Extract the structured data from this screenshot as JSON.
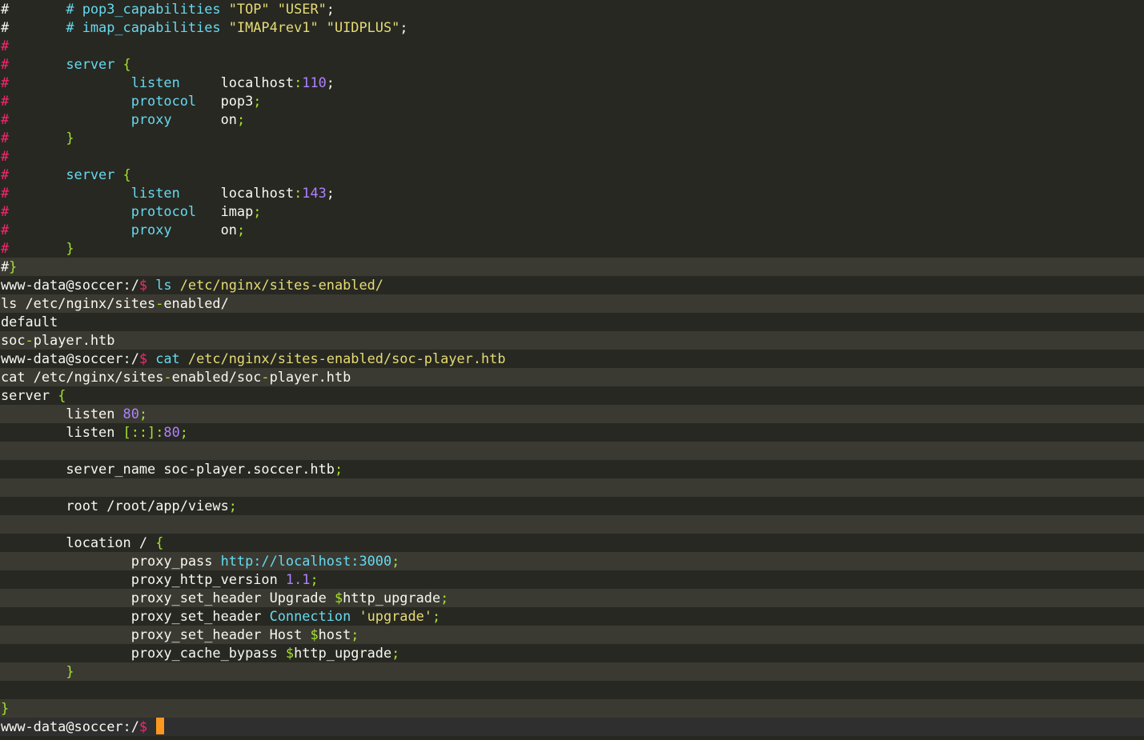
{
  "colors": {
    "background": "#272822",
    "foreground": "#f8f8f2",
    "comment_hash": "#f92672",
    "keyword_blue": "#66d9ef",
    "string_yellow": "#e6db74",
    "number_purple": "#ae81ff",
    "brace_green": "#a6e22e",
    "prompt_dollar": "#f92672",
    "cursor": "#fd971f"
  },
  "terminal": {
    "lines": [
      {
        "tokens": [
          {
            "t": "#",
            "c": "#f8f8f2"
          },
          {
            "t": "       ",
            "c": "#f8f8f2"
          },
          {
            "t": "# pop3_capabilities",
            "c": "#66d9ef"
          },
          {
            "t": " ",
            "c": "#f8f8f2"
          },
          {
            "t": "\"TOP\" \"USER\"",
            "c": "#e6db74"
          },
          {
            "t": ";",
            "c": "#f8f8f2"
          }
        ]
      },
      {
        "tokens": [
          {
            "t": "#",
            "c": "#f8f8f2"
          },
          {
            "t": "       ",
            "c": "#f8f8f2"
          },
          {
            "t": "# imap_capabilities",
            "c": "#66d9ef"
          },
          {
            "t": " ",
            "c": "#f8f8f2"
          },
          {
            "t": "\"IMAP4rev1\" \"UIDPLUS\"",
            "c": "#e6db74"
          },
          {
            "t": ";",
            "c": "#f8f8f2"
          }
        ]
      },
      {
        "tokens": [
          {
            "t": "#",
            "c": "#f92672"
          }
        ]
      },
      {
        "tokens": [
          {
            "t": "#",
            "c": "#f92672"
          },
          {
            "t": "       ",
            "c": "#f8f8f2"
          },
          {
            "t": "server",
            "c": "#66d9ef"
          },
          {
            "t": " ",
            "c": "#f8f8f2"
          },
          {
            "t": "{",
            "c": "#a6e22e"
          }
        ]
      },
      {
        "tokens": [
          {
            "t": "#",
            "c": "#f92672"
          },
          {
            "t": "               ",
            "c": "#f8f8f2"
          },
          {
            "t": "listen",
            "c": "#66d9ef"
          },
          {
            "t": "     localhost",
            "c": "#f8f8f2"
          },
          {
            "t": ":",
            "c": "#a6e22e"
          },
          {
            "t": "110",
            "c": "#ae81ff"
          },
          {
            "t": ";",
            "c": "#f8f8f2"
          }
        ]
      },
      {
        "tokens": [
          {
            "t": "#",
            "c": "#f92672"
          },
          {
            "t": "               ",
            "c": "#f8f8f2"
          },
          {
            "t": "protocol",
            "c": "#66d9ef"
          },
          {
            "t": "   pop3",
            "c": "#f8f8f2"
          },
          {
            "t": ";",
            "c": "#a6e22e"
          }
        ]
      },
      {
        "tokens": [
          {
            "t": "#",
            "c": "#f92672"
          },
          {
            "t": "               ",
            "c": "#f8f8f2"
          },
          {
            "t": "proxy",
            "c": "#66d9ef"
          },
          {
            "t": "      on",
            "c": "#f8f8f2"
          },
          {
            "t": ";",
            "c": "#a6e22e"
          }
        ]
      },
      {
        "tokens": [
          {
            "t": "#",
            "c": "#f92672"
          },
          {
            "t": "       ",
            "c": "#f8f8f2"
          },
          {
            "t": "}",
            "c": "#a6e22e"
          }
        ]
      },
      {
        "tokens": [
          {
            "t": "#",
            "c": "#f92672"
          }
        ]
      },
      {
        "tokens": [
          {
            "t": "#",
            "c": "#f92672"
          },
          {
            "t": "       ",
            "c": "#f8f8f2"
          },
          {
            "t": "server",
            "c": "#66d9ef"
          },
          {
            "t": " ",
            "c": "#f8f8f2"
          },
          {
            "t": "{",
            "c": "#a6e22e"
          }
        ]
      },
      {
        "tokens": [
          {
            "t": "#",
            "c": "#f92672"
          },
          {
            "t": "               ",
            "c": "#f8f8f2"
          },
          {
            "t": "listen",
            "c": "#66d9ef"
          },
          {
            "t": "     localhost",
            "c": "#f8f8f2"
          },
          {
            "t": ":",
            "c": "#a6e22e"
          },
          {
            "t": "143",
            "c": "#ae81ff"
          },
          {
            "t": ";",
            "c": "#f8f8f2"
          }
        ]
      },
      {
        "tokens": [
          {
            "t": "#",
            "c": "#f92672"
          },
          {
            "t": "               ",
            "c": "#f8f8f2"
          },
          {
            "t": "protocol",
            "c": "#66d9ef"
          },
          {
            "t": "   imap",
            "c": "#f8f8f2"
          },
          {
            "t": ";",
            "c": "#a6e22e"
          }
        ]
      },
      {
        "tokens": [
          {
            "t": "#",
            "c": "#f92672"
          },
          {
            "t": "               ",
            "c": "#f8f8f2"
          },
          {
            "t": "proxy",
            "c": "#66d9ef"
          },
          {
            "t": "      on",
            "c": "#f8f8f2"
          },
          {
            "t": ";",
            "c": "#a6e22e"
          }
        ]
      },
      {
        "tokens": [
          {
            "t": "#",
            "c": "#f92672"
          },
          {
            "t": "       ",
            "c": "#f8f8f2"
          },
          {
            "t": "}",
            "c": "#a6e22e"
          }
        ]
      },
      {
        "tokens": [
          {
            "t": "#",
            "c": "#f8f8f2"
          },
          {
            "t": "}",
            "c": "#a6e22e"
          }
        ]
      },
      {
        "tokens": [
          {
            "t": "www-data@soccer:/",
            "c": "#f8f8f2"
          },
          {
            "t": "$",
            "c": "#f92672"
          },
          {
            "t": " ls ",
            "c": "#66d9ef"
          },
          {
            "t": "/etc/nginx/sites-enabled/",
            "c": "#e6db74"
          }
        ]
      },
      {
        "tokens": [
          {
            "t": "ls /etc/nginx/sites",
            "c": "#f8f8f2"
          },
          {
            "t": "-",
            "c": "#a6e22e"
          },
          {
            "t": "enabled/",
            "c": "#f8f8f2"
          }
        ]
      },
      {
        "tokens": [
          {
            "t": "default",
            "c": "#f8f8f2"
          }
        ]
      },
      {
        "tokens": [
          {
            "t": "soc",
            "c": "#f8f8f2"
          },
          {
            "t": "-",
            "c": "#a6e22e"
          },
          {
            "t": "player.htb",
            "c": "#f8f8f2"
          }
        ]
      },
      {
        "tokens": [
          {
            "t": "www-data@soccer:/",
            "c": "#f8f8f2"
          },
          {
            "t": "$",
            "c": "#f92672"
          },
          {
            "t": " cat ",
            "c": "#66d9ef"
          },
          {
            "t": "/etc/nginx/sites-enabled/soc-player.htb",
            "c": "#e6db74"
          }
        ]
      },
      {
        "tokens": [
          {
            "t": "cat /etc/nginx/sites",
            "c": "#f8f8f2"
          },
          {
            "t": "-",
            "c": "#a6e22e"
          },
          {
            "t": "enabled/soc",
            "c": "#f8f8f2"
          },
          {
            "t": "-",
            "c": "#a6e22e"
          },
          {
            "t": "player.htb",
            "c": "#f8f8f2"
          }
        ]
      },
      {
        "tokens": [
          {
            "t": "server ",
            "c": "#f8f8f2"
          },
          {
            "t": "{",
            "c": "#a6e22e"
          }
        ]
      },
      {
        "tokens": [
          {
            "t": "        listen ",
            "c": "#f8f8f2"
          },
          {
            "t": "80",
            "c": "#ae81ff"
          },
          {
            "t": ";",
            "c": "#a6e22e"
          }
        ]
      },
      {
        "tokens": [
          {
            "t": "        listen ",
            "c": "#f8f8f2"
          },
          {
            "t": "[::]:",
            "c": "#a6e22e"
          },
          {
            "t": "80",
            "c": "#ae81ff"
          },
          {
            "t": ";",
            "c": "#a6e22e"
          }
        ]
      },
      {
        "tokens": [
          {
            "t": "",
            "c": "#f8f8f2"
          }
        ]
      },
      {
        "tokens": [
          {
            "t": "        server_name soc-player.soccer.htb",
            "c": "#f8f8f2"
          },
          {
            "t": ";",
            "c": "#a6e22e"
          }
        ]
      },
      {
        "tokens": [
          {
            "t": "",
            "c": "#f8f8f2"
          }
        ]
      },
      {
        "tokens": [
          {
            "t": "        root /root/app/views",
            "c": "#f8f8f2"
          },
          {
            "t": ";",
            "c": "#a6e22e"
          }
        ]
      },
      {
        "tokens": [
          {
            "t": "",
            "c": "#f8f8f2"
          }
        ]
      },
      {
        "tokens": [
          {
            "t": "        location / ",
            "c": "#f8f8f2"
          },
          {
            "t": "{",
            "c": "#a6e22e"
          }
        ]
      },
      {
        "tokens": [
          {
            "t": "                proxy_pass ",
            "c": "#f8f8f2"
          },
          {
            "t": "http://localhost:3000",
            "c": "#66d9ef"
          },
          {
            "t": ";",
            "c": "#a6e22e"
          }
        ]
      },
      {
        "tokens": [
          {
            "t": "                proxy_http_version ",
            "c": "#f8f8f2"
          },
          {
            "t": "1.1",
            "c": "#ae81ff"
          },
          {
            "t": ";",
            "c": "#a6e22e"
          }
        ]
      },
      {
        "tokens": [
          {
            "t": "                proxy_set_header Upgrade ",
            "c": "#f8f8f2"
          },
          {
            "t": "$",
            "c": "#a6e22e"
          },
          {
            "t": "http_upgrade",
            "c": "#f8f8f2"
          },
          {
            "t": ";",
            "c": "#a6e22e"
          }
        ]
      },
      {
        "tokens": [
          {
            "t": "                proxy_set_header ",
            "c": "#f8f8f2"
          },
          {
            "t": "Connection",
            "c": "#66d9ef"
          },
          {
            "t": " ",
            "c": "#f8f8f2"
          },
          {
            "t": "'upgrade'",
            "c": "#e6db74"
          },
          {
            "t": ";",
            "c": "#a6e22e"
          }
        ]
      },
      {
        "tokens": [
          {
            "t": "                proxy_set_header Host ",
            "c": "#f8f8f2"
          },
          {
            "t": "$",
            "c": "#a6e22e"
          },
          {
            "t": "host",
            "c": "#f8f8f2"
          },
          {
            "t": ";",
            "c": "#a6e22e"
          }
        ]
      },
      {
        "tokens": [
          {
            "t": "                proxy_cache_bypass ",
            "c": "#f8f8f2"
          },
          {
            "t": "$",
            "c": "#a6e22e"
          },
          {
            "t": "http_upgrade",
            "c": "#f8f8f2"
          },
          {
            "t": ";",
            "c": "#a6e22e"
          }
        ]
      },
      {
        "tokens": [
          {
            "t": "        ",
            "c": "#f8f8f2"
          },
          {
            "t": "}",
            "c": "#a6e22e"
          }
        ]
      },
      {
        "tokens": [
          {
            "t": "",
            "c": "#f8f8f2"
          }
        ]
      },
      {
        "tokens": [
          {
            "t": "}",
            "c": "#a6e22e"
          }
        ]
      },
      {
        "tokens": [
          {
            "t": "www-data@soccer:/",
            "c": "#f8f8f2"
          },
          {
            "t": "$",
            "c": "#f92672"
          },
          {
            "t": " ",
            "c": "#f8f8f2"
          }
        ],
        "cursor": true
      }
    ]
  }
}
